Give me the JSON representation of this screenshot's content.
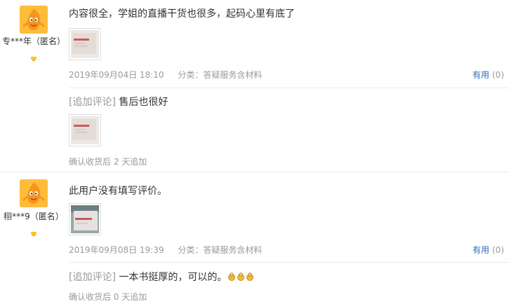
{
  "reviews": [
    {
      "user": {
        "name": "专***年（匿名）",
        "avatar_icon": "mascot-avatar-icon",
        "vip_icon": "diamond-icon"
      },
      "comment": "内容很全，学姐的直播干货也很多，起码心里有底了",
      "date": "2019年09月04日 18:10",
      "category": "分类：答疑服务含材料",
      "useful_label": "有用",
      "useful_count": "(0)",
      "append": {
        "tag": "[追加评论]",
        "text": "售后也很好",
        "note": "确认收货后 2 天追加"
      }
    },
    {
      "user": {
        "name": "栩***9（匿名）",
        "avatar_icon": "mascot-avatar-icon",
        "vip_icon": "diamond-icon"
      },
      "comment": "此用户没有填写评价。",
      "date": "2019年09月08日 19:39",
      "category": "分类：答疑服务含材料",
      "useful_label": "有用",
      "useful_count": "(0)",
      "append": {
        "tag": "[追加评论]",
        "text": "一本书挺厚的，可以的。",
        "emoji_icon": "ok-hand-icon",
        "note": "确认收货后 0 天追加"
      }
    }
  ],
  "colors": {
    "link": "#2c6cb7",
    "meta": "#999999",
    "avatar": "#fdbd3a",
    "divider": "#e6e6e6"
  }
}
